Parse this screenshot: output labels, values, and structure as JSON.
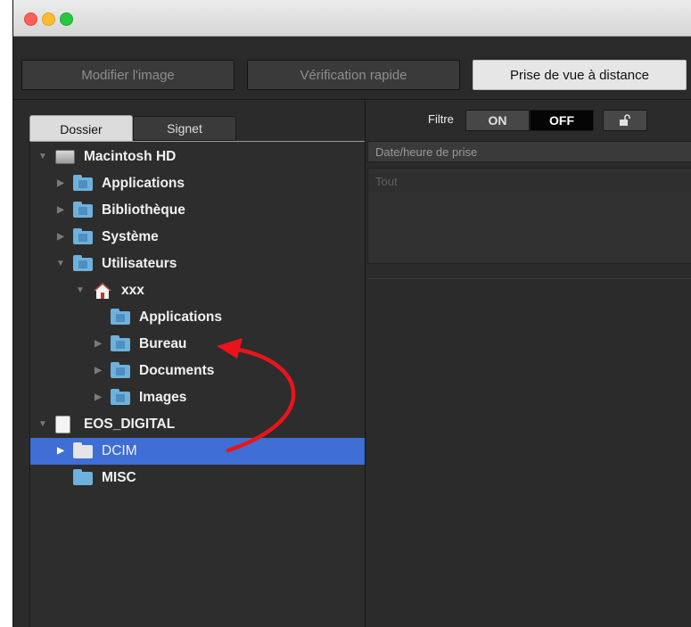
{
  "toolbar": {
    "buttons": [
      {
        "label": "Modifier l'image",
        "active": false
      },
      {
        "label": "Vérification rapide",
        "active": false
      },
      {
        "label": "Prise de vue à distance",
        "active": true
      }
    ]
  },
  "left_panel": {
    "tabs": [
      {
        "label": "Dossier",
        "active": true
      },
      {
        "label": "Signet",
        "active": false
      }
    ],
    "tree": [
      {
        "label": "Macintosh HD",
        "icon": "hard-drive-icon",
        "expanded": true,
        "level": 0
      },
      {
        "label": "Applications",
        "icon": "folder-applications-icon",
        "expanded": false,
        "level": 1
      },
      {
        "label": "Bibliothèque",
        "icon": "folder-library-icon",
        "expanded": false,
        "level": 1
      },
      {
        "label": "Système",
        "icon": "folder-system-icon",
        "expanded": false,
        "level": 1
      },
      {
        "label": "Utilisateurs",
        "icon": "folder-users-icon",
        "expanded": true,
        "level": 1
      },
      {
        "label": "xxx",
        "icon": "home-icon",
        "expanded": true,
        "level": 2
      },
      {
        "label": "Applications",
        "icon": "folder-applications-icon",
        "expanded": null,
        "level": 3
      },
      {
        "label": "Bureau",
        "icon": "folder-desktop-icon",
        "expanded": false,
        "level": 3
      },
      {
        "label": "Documents",
        "icon": "folder-documents-icon",
        "expanded": false,
        "level": 3
      },
      {
        "label": "Images",
        "icon": "folder-images-icon",
        "expanded": false,
        "level": 3
      },
      {
        "label": "EOS_DIGITAL",
        "icon": "removable-drive-icon",
        "expanded": true,
        "level": 0
      },
      {
        "label": "DCIM",
        "icon": "folder-icon",
        "expanded": false,
        "level": 1,
        "selected": true
      },
      {
        "label": "MISC",
        "icon": "folder-icon",
        "expanded": null,
        "level": 1
      }
    ]
  },
  "right_panel": {
    "filter_label": "Filtre",
    "on_label": "ON",
    "off_label": "OFF",
    "filter_state": "OFF",
    "lock_icon": "unlock-icon",
    "date_header": "Date/heure de prise",
    "list_items": [
      "Tout"
    ]
  },
  "colors": {
    "selection": "#3f6ed4",
    "folder": "#6db1dc",
    "annotation_arrow": "#e8141c"
  }
}
